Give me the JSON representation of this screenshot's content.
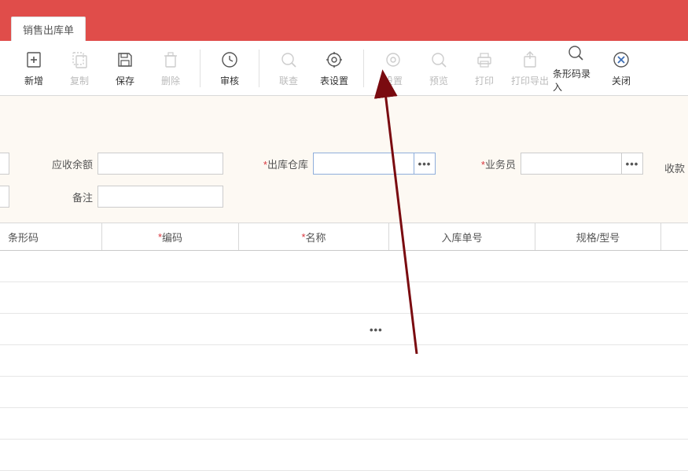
{
  "tab": {
    "title": "销售出库单"
  },
  "toolbar": {
    "new": "新增",
    "copy": "复制",
    "save": "保存",
    "delete": "删除",
    "audit": "审核",
    "link": "联查",
    "table_settings": "表设置",
    "settings": "设置",
    "preview": "预览",
    "print": "打印",
    "print_export": "打印导出",
    "barcode_entry": "条形码录入",
    "close": "关闭"
  },
  "form": {
    "receivable_balance": {
      "label": "应收余额",
      "value": ""
    },
    "out_warehouse": {
      "label": "出库仓库",
      "value": ""
    },
    "salesperson": {
      "label": "业务员",
      "value": ""
    },
    "remark": {
      "label": "备注",
      "value": ""
    },
    "receipt": {
      "label": "收款"
    }
  },
  "table": {
    "headers": {
      "barcode": "条形码",
      "code": "编码",
      "name": "名称",
      "inbound_no": "入库单号",
      "spec": "规格/型号"
    }
  }
}
